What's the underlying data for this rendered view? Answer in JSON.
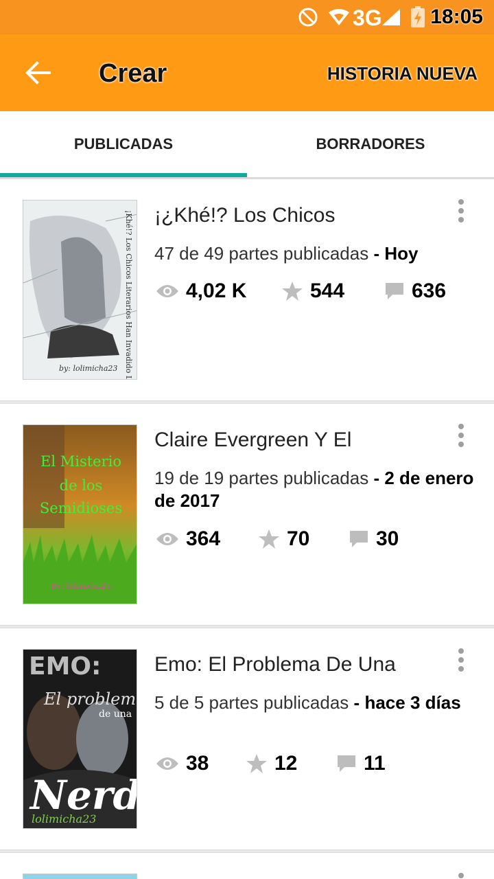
{
  "status_bar": {
    "time": "18:05",
    "network": "3G"
  },
  "app_bar": {
    "title": "Crear",
    "new_story_label": "HISTORIA NUEVA"
  },
  "tabs": [
    {
      "label": "PUBLICADAS",
      "active": true
    },
    {
      "label": "BORRADORES",
      "active": false
    }
  ],
  "stories": [
    {
      "title": "¡¿Khé!? Los Chicos",
      "parts": "47 de 49 partes publicadas",
      "separator": "-",
      "updated": "Hoy",
      "views": "4,02 K",
      "votes": "544",
      "comments": "636",
      "cover": {
        "text_top": "¡Khé!? Los Chicos Literarios Han Invadido La Clase",
        "text_bottom": "by: lolimicha23"
      }
    },
    {
      "title": "Claire Evergreen Y El",
      "parts": "19 de 19 partes publicadas",
      "separator": "-",
      "updated": "2 de enero de 2017",
      "views": "364",
      "votes": "70",
      "comments": "30",
      "cover": {
        "line1": "El Misterio",
        "line2": "de los",
        "line3": "Semidioses",
        "text_bottom": "By: lolimicha23"
      }
    },
    {
      "title": "Emo: El Problema De Una",
      "parts": "5 de 5 partes publicadas",
      "separator": "-",
      "updated": "hace 3 días",
      "views": "38",
      "votes": "12",
      "comments": "11",
      "cover": {
        "line1": "EMO:",
        "line2": "El problema",
        "line3": "de una",
        "line4": "Nerd",
        "text_bottom": "lolimicha23"
      }
    }
  ],
  "colors": {
    "status_bar": "#f7931e",
    "app_bar": "#ff9a14",
    "tab_indicator": "#13a89e",
    "stat_icon": "#bdbdbd"
  }
}
